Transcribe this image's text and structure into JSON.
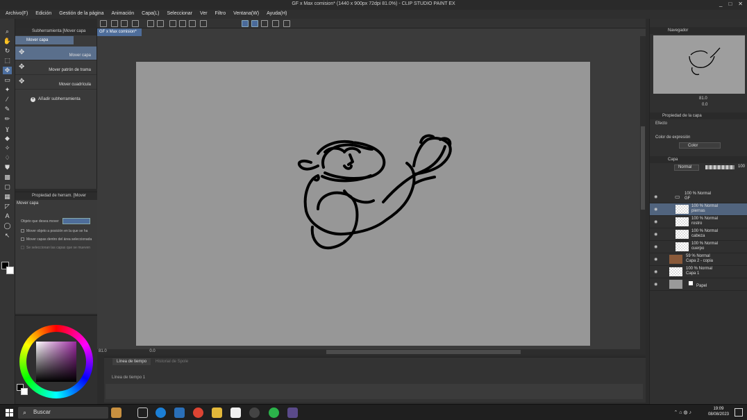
{
  "window": {
    "title": "GF x Max comision* (1440 x 900px 72dpi 81.0%) - CLIP STUDIO PAINT EX",
    "controls": [
      "_",
      "□",
      "✕"
    ]
  },
  "menu": [
    "Archivo(F)",
    "Edición",
    "Gestión de la página",
    "Animación",
    "Capa(L)",
    "Seleccionar",
    "Ver",
    "Filtro",
    "Ventana(W)",
    "Ayuda(H)"
  ],
  "subtool": {
    "header": "Subherramienta [Mover capa",
    "group_label": "Mover capa",
    "items": [
      "Mover capa",
      "Mover patrón de trama",
      "Mover cuadrícula"
    ],
    "add_label": "Añadir subherramienta"
  },
  "toolprop": {
    "header": "Propiedad de herram. [Mover",
    "title": "Mover capa",
    "target_label": "Objeto que desea mover",
    "options": [
      "Mover objeto a posición en la que se ha",
      "Mover capas dentro del área seleccionada",
      "Se seleccionan las capas que se mueven"
    ]
  },
  "canvas": {
    "doc_tab": "GF x Max comision*",
    "zoom": "81.0",
    "angle": "0.0"
  },
  "timeline": {
    "tab": "Línea de tiempo",
    "tab2": "Historial de Spole",
    "select": "Línea de tiempo 1"
  },
  "navigator": {
    "header": "Navegador",
    "zoom": "81.0",
    "angle": "0.0"
  },
  "layerprop": {
    "header": "Propiedad de la capa",
    "effect_label": "Efecto",
    "color_expr_label": "Color de expresión",
    "color_value": "Color"
  },
  "layers": {
    "header": "Capa",
    "blend": "Normal",
    "opacity": "100",
    "items": [
      {
        "line1": "100 % Normal",
        "line2": "GF",
        "folder": true,
        "selected": false
      },
      {
        "line1": "100 % Normal",
        "line2": "piernas",
        "folder": false,
        "selected": true
      },
      {
        "line1": "100 % Normal",
        "line2": "rostro",
        "folder": false,
        "selected": false
      },
      {
        "line1": "100 % Normal",
        "line2": "cabeza",
        "folder": false,
        "selected": false
      },
      {
        "line1": "100 % Normal",
        "line2": "cuerpo",
        "folder": false,
        "selected": false
      },
      {
        "line1": "59 % Normal",
        "line2": "Capa 2 - copia",
        "folder": false,
        "selected": false
      },
      {
        "line1": "100 % Normal",
        "line2": "Capa 1",
        "folder": false,
        "selected": false
      },
      {
        "line1": "",
        "line2": "Papel",
        "folder": false,
        "selected": false
      }
    ]
  },
  "taskbar": {
    "search": "Buscar",
    "time": "19:09",
    "date": "08/08/2023"
  },
  "colors": {
    "accent": "#4e6d9a",
    "paper": "#979797",
    "panel": "#3a3a3a"
  }
}
